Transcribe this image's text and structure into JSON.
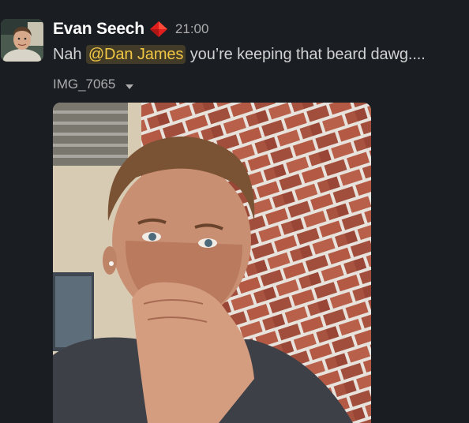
{
  "message": {
    "sender": "Evan Seech",
    "status_icon": "red-diamond-icon",
    "timestamp": "21:00",
    "text_before": "Nah ",
    "mention": "@Dan James",
    "text_after": " you’re keeping that beard dawg....",
    "mention_color": "#f2c744"
  },
  "attachment": {
    "file_name": "IMG_7065",
    "dropdown_icon": "caret-down-icon"
  },
  "colors": {
    "background": "#1a1d21",
    "text": "#d1d2d3",
    "muted": "#ababad",
    "sender": "#ffffff",
    "status_red": "#e01e1e"
  }
}
